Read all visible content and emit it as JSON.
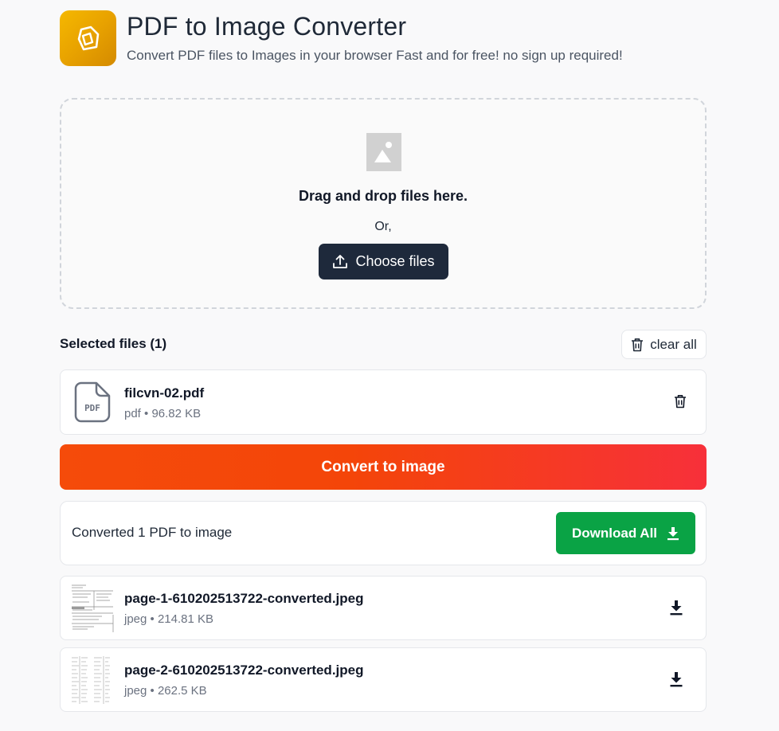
{
  "header": {
    "title": "PDF to Image Converter",
    "subtitle": "Convert PDF files to Images in your browser Fast and for free! no sign up required!",
    "logo_icon": "document-logo-icon",
    "logo_color": "#f0b000"
  },
  "dropzone": {
    "icon": "image-placeholder-icon",
    "text": "Drag and drop files here.",
    "or_text": "Or,",
    "choose_label": "Choose files"
  },
  "selected": {
    "title": "Selected files (1)",
    "clear_label": "clear all",
    "files": [
      {
        "name": "filcvn-02.pdf",
        "meta": "pdf • 96.82 KB",
        "icon": "pdf-file-icon"
      }
    ]
  },
  "convert": {
    "label": "Convert to image",
    "color_start": "#f54b0a",
    "color_end": "#f7303a"
  },
  "result": {
    "text": "Converted 1 PDF to image",
    "download_all_label": "Download All",
    "download_color": "#0aa345"
  },
  "images": [
    {
      "name": "page-1-610202513722-converted.jpeg",
      "meta": "jpeg • 214.81 KB"
    },
    {
      "name": "page-2-610202513722-converted.jpeg",
      "meta": "jpeg • 262.5 KB"
    }
  ]
}
